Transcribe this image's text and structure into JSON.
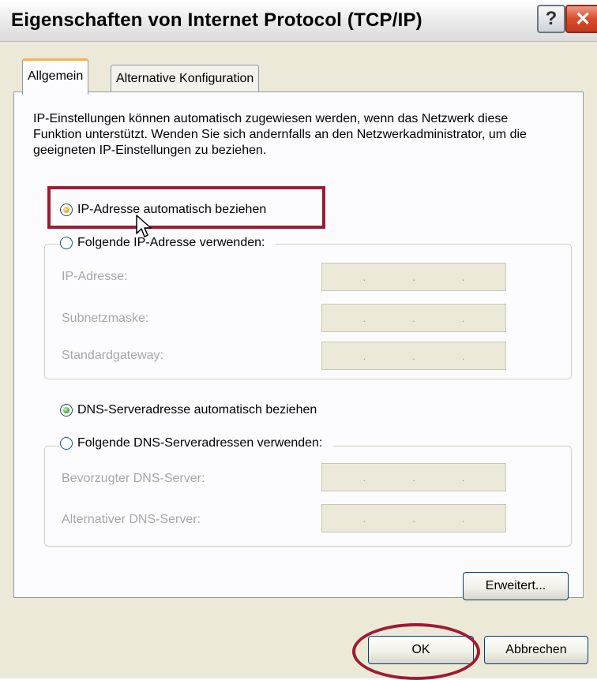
{
  "window": {
    "title": "Eigenschaften von Internet Protocol (TCP/IP)",
    "help_glyph": "?",
    "close_glyph": "✕",
    "help_icon": "help-icon",
    "close_icon": "close-icon"
  },
  "tabs": [
    {
      "label": "Allgemein",
      "active": true
    },
    {
      "label": "Alternative Konfiguration",
      "active": false
    }
  ],
  "intro_text": "IP-Einstellungen können automatisch zugewiesen werden, wenn das Netzwerk diese Funktion unterstützt. Wenden Sie sich andernfalls an den Netzwerkadministrator, um die geeigneten IP-Einstellungen zu beziehen.",
  "ip": {
    "auto_label": "IP-Adresse automatisch beziehen",
    "manual_label": "Folgende IP-Adresse verwenden:",
    "fields": [
      {
        "label": "IP-Adresse:",
        "value": ".   .   ."
      },
      {
        "label": "Subnetzmaske:",
        "value": ".   .   ."
      },
      {
        "label": "Standardgateway:",
        "value": ".   .   ."
      }
    ]
  },
  "dns": {
    "auto_label": "DNS-Serveradresse automatisch beziehen",
    "manual_label": "Folgende DNS-Serveradressen verwenden:",
    "fields": [
      {
        "label": "Bevorzugter DNS-Server:",
        "value": ".   .   ."
      },
      {
        "label": "Alternativer DNS-Server:",
        "value": ".   .   ."
      }
    ]
  },
  "buttons": {
    "advanced": "Erweitert...",
    "ok": "OK",
    "cancel": "Abbrechen"
  },
  "colors": {
    "annotation": "#9e1b32",
    "window_bg": "#ece9d8"
  }
}
